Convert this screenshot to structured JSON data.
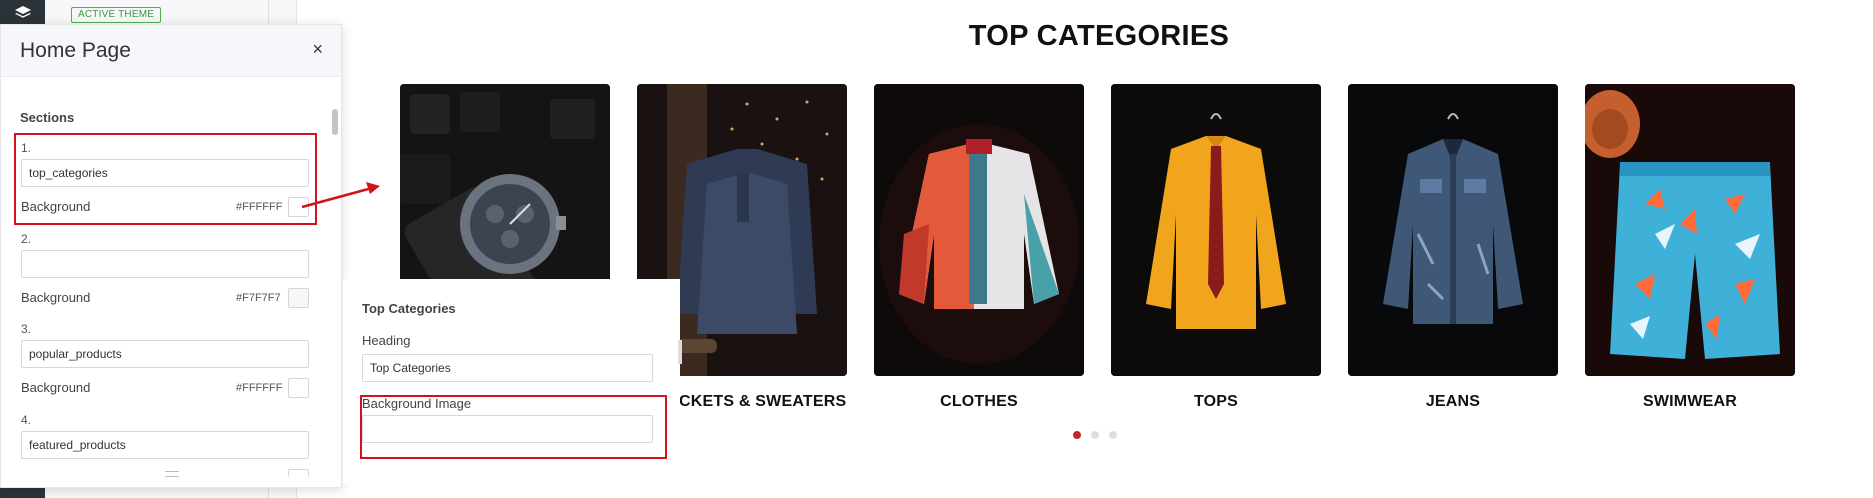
{
  "theme_badge": "ACTIVE THEME",
  "panel": {
    "title": "Home Page",
    "close_icon": "×",
    "sections_heading": "Sections",
    "sections": [
      {
        "number": "1.",
        "value": "top_categories",
        "bg_label": "Background",
        "bg_value": "#FFFFFF",
        "swatch": "#ffffff"
      },
      {
        "number": "2.",
        "value": "",
        "bg_label": "Background",
        "bg_value": "#F7F7F7",
        "swatch": "#f7f7f7"
      },
      {
        "number": "3.",
        "value": "popular_products",
        "bg_label": "Background",
        "bg_value": "#FFFFFF",
        "swatch": "#ffffff"
      },
      {
        "number": "4.",
        "value": "featured_products"
      }
    ]
  },
  "subpanel": {
    "title": "Top Categories",
    "heading_label": "Heading",
    "heading_value": "Top Categories",
    "bg_image_label": "Background Image",
    "bg_image_value": ""
  },
  "storefront": {
    "title": "TOP CATEGORIES",
    "categories": [
      {
        "label": "",
        "image": "watch"
      },
      {
        "label": "CKETS & SWEATERS",
        "image": "sweaters"
      },
      {
        "label": "CLOTHES",
        "image": "bomber-jacket"
      },
      {
        "label": "TOPS",
        "image": "yellow-shirt"
      },
      {
        "label": "JEANS",
        "image": "denim-jacket"
      },
      {
        "label": "SWIMWEAR",
        "image": "swim-shorts"
      }
    ],
    "pagination": {
      "total": 3,
      "active": 1
    }
  },
  "colors": {
    "highlight": "#d0121b",
    "active_dot": "#c62828",
    "badge": "#3c9a3f"
  }
}
